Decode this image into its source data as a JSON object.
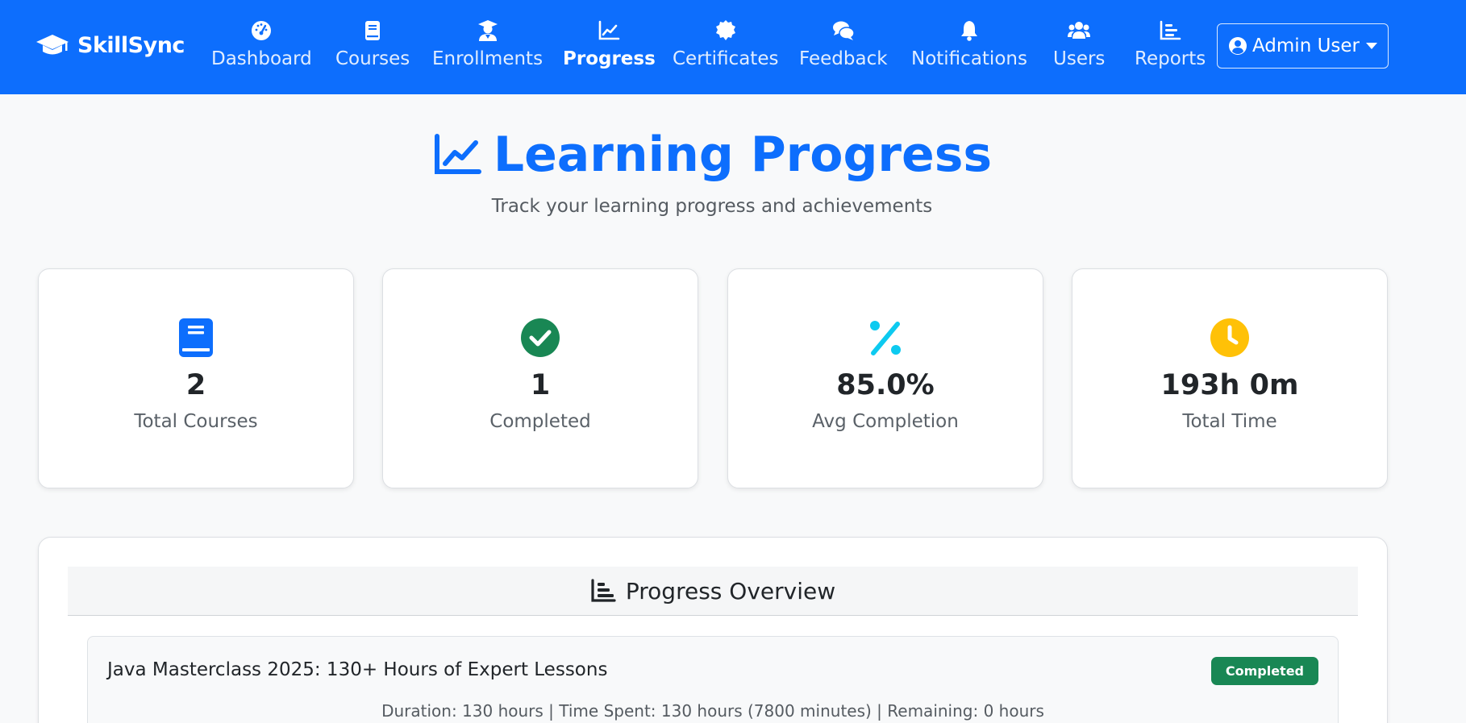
{
  "brand": {
    "name": "SkillSync",
    "icon": "graduation-cap-icon"
  },
  "nav": {
    "items": [
      {
        "label": "Dashboard",
        "icon": "tachometer-icon"
      },
      {
        "label": "Courses",
        "icon": "book-icon"
      },
      {
        "label": "Enrollments",
        "icon": "user-graduate-icon"
      },
      {
        "label": "Progress",
        "icon": "chart-line-icon",
        "active": true
      },
      {
        "label": "Certificates",
        "icon": "certificate-icon"
      },
      {
        "label": "Feedback",
        "icon": "comments-icon"
      },
      {
        "label": "Notifications",
        "icon": "bell-icon"
      },
      {
        "label": "Users",
        "icon": "users-icon"
      },
      {
        "label": "Reports",
        "icon": "chart-bar-icon"
      }
    ],
    "user_menu": {
      "label": "Admin User",
      "icon": "user-circle-icon"
    }
  },
  "page": {
    "title": "Learning Progress",
    "subtitle": "Track your learning progress and achievements"
  },
  "stats": [
    {
      "value": "2",
      "label": "Total Courses",
      "icon": "book-icon",
      "color": "#0d6efd"
    },
    {
      "value": "1",
      "label": "Completed",
      "icon": "check-circle-icon",
      "color": "#198754"
    },
    {
      "value": "85.0%",
      "label": "Avg Completion",
      "icon": "percent-icon",
      "color": "#0dcaf0"
    },
    {
      "value": "193h 0m",
      "label": "Total Time",
      "icon": "clock-icon",
      "color": "#ffc107"
    }
  ],
  "overview": {
    "title": "Progress Overview",
    "icon": "chart-bar-icon",
    "courses": [
      {
        "title": "Java Masterclass 2025: 130+ Hours of Expert Lessons",
        "status": "Completed",
        "meta": "Duration: 130 hours | Time Spent: 130 hours (7800 minutes) | Remaining: 0 hours"
      }
    ]
  },
  "colors": {
    "primary": "#0d6efd",
    "success": "#198754",
    "info": "#0dcaf0",
    "warning": "#ffc107"
  }
}
